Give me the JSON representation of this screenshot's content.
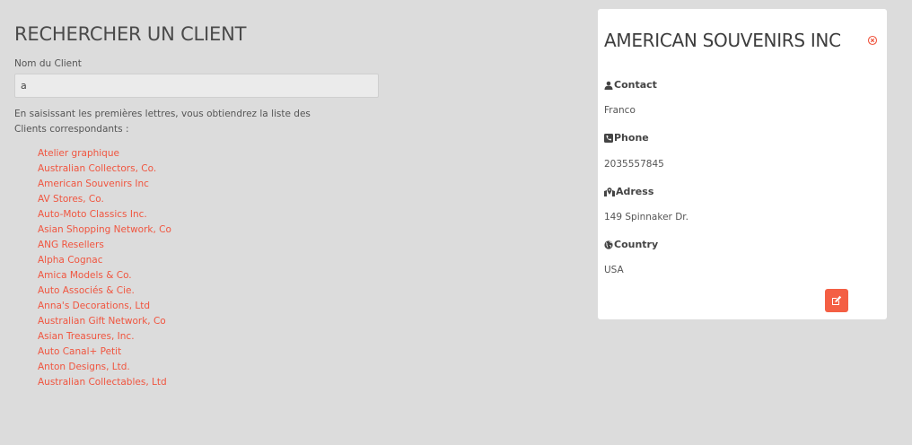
{
  "search": {
    "title": "RECHERCHER UN CLIENT",
    "field_label": "Nom du Client",
    "query_value": "a",
    "hint": "En saisissant les premières lettres, vous obtiendrez la liste des Clients correspondants :",
    "results": [
      "Atelier graphique",
      "Australian Collectors, Co.",
      "American Souvenirs Inc",
      "AV Stores, Co.",
      "Auto-Moto Classics Inc.",
      "Asian Shopping Network, Co",
      "ANG Resellers",
      "Alpha Cognac",
      "Amica Models & Co.",
      "Auto Associés & Cie.",
      "Anna's Decorations, Ltd",
      "Australian Gift Network, Co",
      "Asian Treasures, Inc.",
      "Auto Canal+ Petit",
      "Anton Designs, Ltd.",
      "Australian Collectables, Ltd"
    ]
  },
  "card": {
    "title": "AMERICAN SOUVENIRS INC",
    "contact_label": "Contact",
    "contact_value": "Franco",
    "phone_label": "Phone",
    "phone_value": "2035557845",
    "address_label": "Adress",
    "address_value": "149 Spinnaker Dr.",
    "country_label": "Country",
    "country_value": "USA"
  },
  "colors": {
    "accent": "#f45f44",
    "link": "#f0553f",
    "background": "#dcdcdc",
    "card": "#ffffff"
  },
  "icons": {
    "contact": "user-icon",
    "phone": "phone-icon",
    "address": "map-marker-icon",
    "country": "globe-icon",
    "close": "close-circle-icon",
    "edit": "edit-icon"
  }
}
